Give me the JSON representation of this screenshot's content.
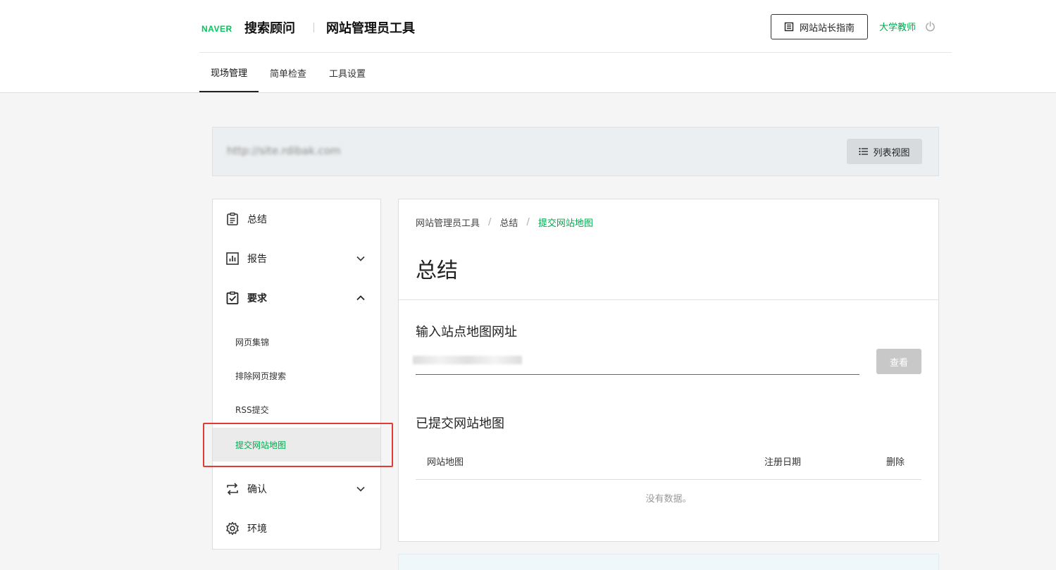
{
  "header": {
    "logo_naver": "NAVER",
    "logo_sub": "搜索顾问",
    "logo_tool": "网站管理员工具",
    "guide_label": "网站站长指南",
    "user_name": "大学教师"
  },
  "nav": {
    "tabs": [
      {
        "label": "现场管理",
        "active": true
      },
      {
        "label": "简单检查",
        "active": false
      },
      {
        "label": "工具设置",
        "active": false
      }
    ]
  },
  "site_bar": {
    "url": "http://site.rdibak.com",
    "list_view_label": "列表视图"
  },
  "sidebar": {
    "items": [
      {
        "label": "总结",
        "icon": "clipboard-icon"
      },
      {
        "label": "报告",
        "icon": "chart-icon"
      },
      {
        "label": "要求",
        "icon": "checklist-icon"
      },
      {
        "label": "确认",
        "icon": "swap-icon"
      },
      {
        "label": "环境",
        "icon": "gear-icon"
      }
    ],
    "sub_items": [
      {
        "label": "网页集锦"
      },
      {
        "label": "排除网页搜索"
      },
      {
        "label": "RSS提交"
      },
      {
        "label": "提交网站地图"
      }
    ]
  },
  "content": {
    "breadcrumb": [
      "网站管理员工具",
      "总结",
      "提交网站地图"
    ],
    "title": "总结",
    "section1_title": "输入站点地图网址",
    "url_placeholder": "",
    "query_label": "查看",
    "section2_title": "已提交网站地图",
    "table_headers": [
      "网站地图",
      "注册日期",
      "删除"
    ],
    "no_data": "没有数据。"
  },
  "colors": {
    "accent": "#03a84e",
    "naver_green": "#03c75a",
    "highlight": "#e53935"
  }
}
